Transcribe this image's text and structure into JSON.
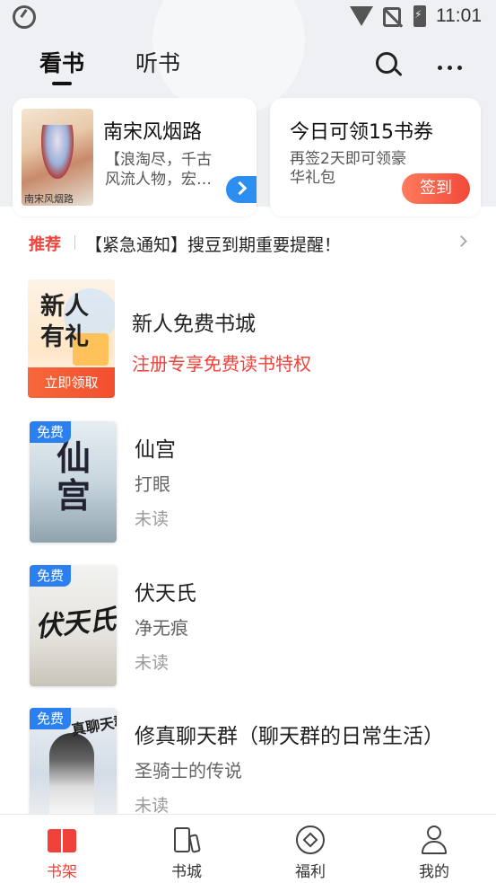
{
  "status_bar": {
    "time": "11:01"
  },
  "header": {
    "tabs": [
      {
        "label": "看书",
        "active": true
      },
      {
        "label": "听书",
        "active": false
      }
    ]
  },
  "cards": {
    "book": {
      "cover_title": "南宋风烟路",
      "title": "南宋风烟路",
      "desc": "【浪淘尽，千古风流人物，宏…"
    },
    "sign": {
      "title": "今日可领15书券",
      "desc": "再签2天即可领豪华礼包",
      "button": "签到"
    }
  },
  "notice": {
    "tag": "推荐",
    "text": "【紧急通知】搜豆到期重要提醒！"
  },
  "promo": {
    "image_text": "新人有礼",
    "image_button": "立即领取",
    "title": "新人免费书城",
    "subtitle": "注册专享免费读书特权"
  },
  "books": [
    {
      "badge": "免费",
      "cover_text": "仙宫",
      "title": "仙宫",
      "author": "打眼",
      "status": "未读"
    },
    {
      "badge": "免费",
      "cover_text": "伏天氏",
      "title": "伏天氏",
      "author": "净无痕",
      "status": "未读"
    },
    {
      "badge": "免费",
      "cover_text": "真聊天群",
      "title": "修真聊天群（聊天群的日常生活）",
      "author": "圣骑士的传说",
      "status": "未读"
    }
  ],
  "bottom_nav": [
    {
      "label": "书架",
      "icon": "bookshelf-icon",
      "active": true
    },
    {
      "label": "书城",
      "icon": "bookstore-icon",
      "active": false
    },
    {
      "label": "福利",
      "icon": "welfare-icon",
      "active": false
    },
    {
      "label": "我的",
      "icon": "profile-icon",
      "active": false
    }
  ],
  "colors": {
    "accent": "#f0423a",
    "badge_blue": "#2c7ff0",
    "top_bg": "#eef0f3"
  }
}
